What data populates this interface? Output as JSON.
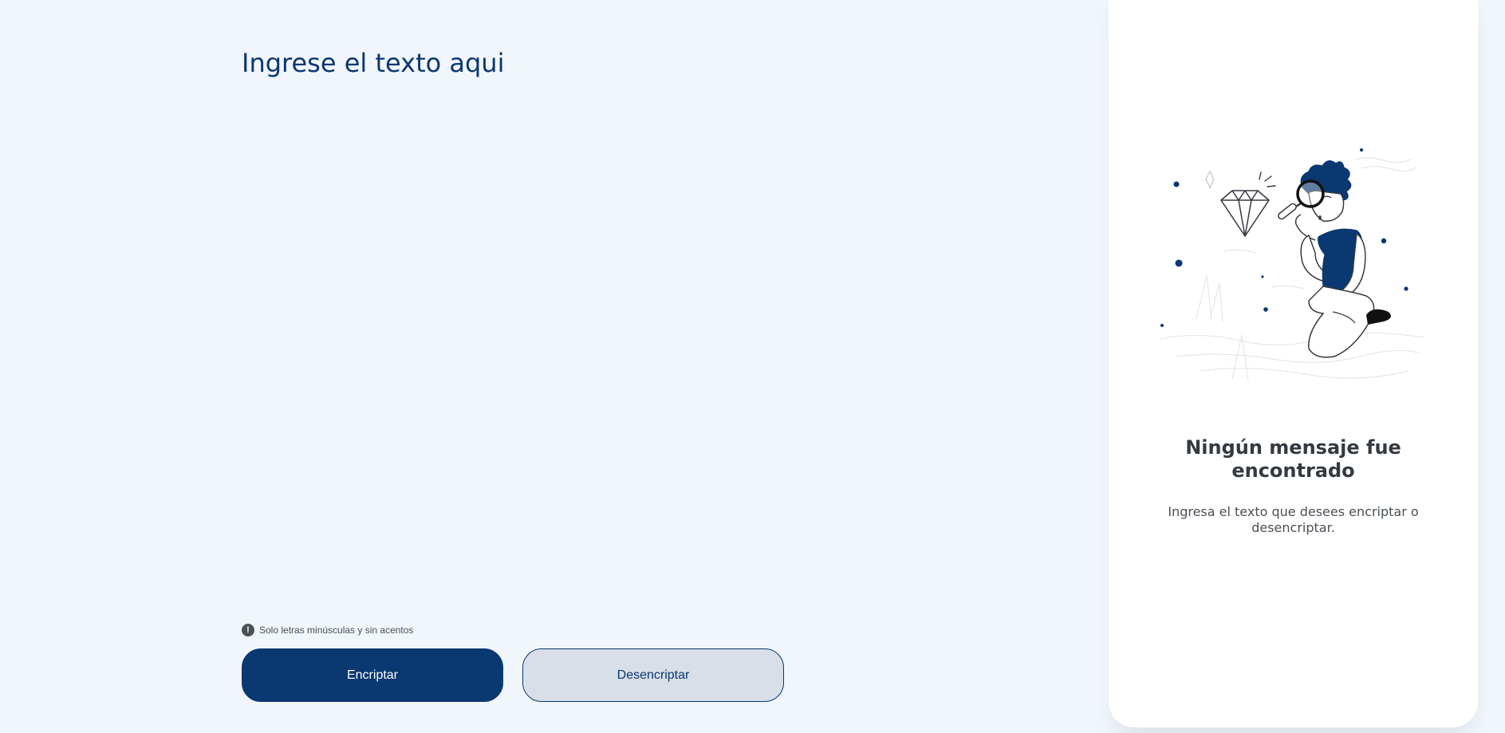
{
  "input": {
    "placeholder": "Ingrese el texto aqui",
    "value": ""
  },
  "hint": {
    "icon": "exclamation-circle-icon",
    "text": "Solo letras minúsculas y sin acentos"
  },
  "buttons": {
    "encrypt_label": "Encriptar",
    "decrypt_label": "Desencriptar"
  },
  "output_panel": {
    "illustration": "person-with-magnifying-glass-illustration",
    "title": "Ningún mensaje fue encontrado",
    "message": "Ingresa el texto que desees encriptar o desencriptar."
  },
  "colors": {
    "background": "#f1f5fc",
    "primary": "#0a3871",
    "secondary_button": "#d8dfe8",
    "panel": "#ffffff",
    "heading_text": "#343a40",
    "body_text": "#495057"
  }
}
